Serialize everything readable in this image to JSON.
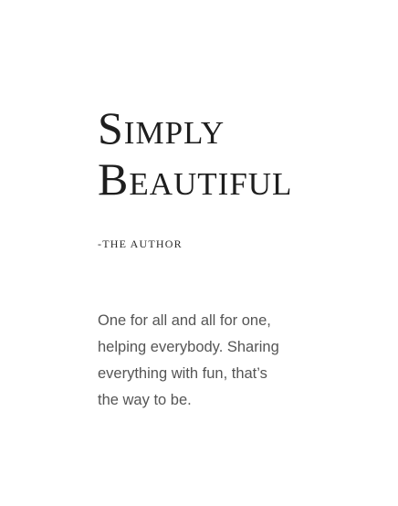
{
  "quote": {
    "title_lines": [
      "Simply",
      "Beautiful"
    ],
    "author": "-The Author",
    "body_lines": [
      "One for all and all for one,",
      "helping everybody. Sharing",
      "everything with fun, that’s",
      "the way to be."
    ]
  },
  "colors": {
    "background": "#ffffff",
    "title": "#1e1e1e",
    "author": "#2a2a2a",
    "body": "#555555"
  }
}
